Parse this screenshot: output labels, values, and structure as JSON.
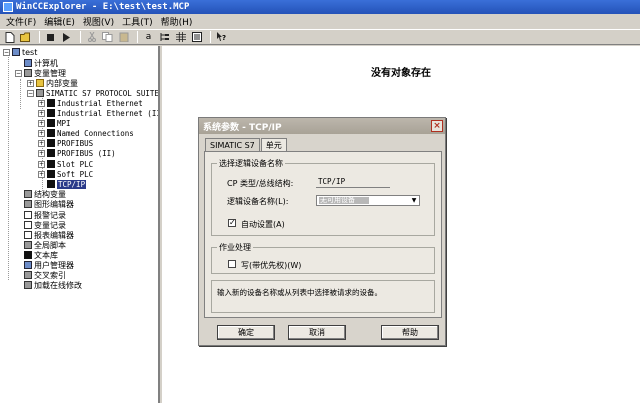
{
  "window": {
    "title": "WinCCExplorer - E:\\test\\test.MCP"
  },
  "menu": [
    "文件(F)",
    "编辑(E)",
    "视图(V)",
    "工具(T)",
    "帮助(H)"
  ],
  "toolbar": {
    "buttons": [
      "new-icon",
      "open-icon",
      "stop-icon",
      "run-icon",
      "cut-icon",
      "copy-icon",
      "paste-icon",
      "text-icon",
      "tree-icon",
      "grid-icon",
      "list-icon",
      "help-icon"
    ],
    "text_button_label": "a"
  },
  "tree": {
    "items": [
      {
        "label": "test",
        "expander": "−"
      },
      {
        "label": "计算机"
      },
      {
        "label": "变量管理",
        "expander": "−"
      },
      {
        "label": "内部变量",
        "expander": "+"
      },
      {
        "label": "SIMATIC S7 PROTOCOL SUITE",
        "expander": "−"
      },
      {
        "label": "Industrial Ethernet",
        "expander": "+"
      },
      {
        "label": "Industrial Ethernet (II)",
        "expander": "+"
      },
      {
        "label": "MPI",
        "expander": "+"
      },
      {
        "label": "Named Connections",
        "expander": "+"
      },
      {
        "label": "PROFIBUS",
        "expander": "+"
      },
      {
        "label": "PROFIBUS (II)",
        "expander": "+"
      },
      {
        "label": "Slot PLC",
        "expander": "+"
      },
      {
        "label": "Soft PLC",
        "expander": "+"
      },
      {
        "label": "TCP/IP",
        "selected": true
      },
      {
        "label": "结构变量"
      },
      {
        "label": "图形编辑器"
      },
      {
        "label": "报警记录"
      },
      {
        "label": "变量记录"
      },
      {
        "label": "报表编辑器"
      },
      {
        "label": "全局脚本"
      },
      {
        "label": "文本库"
      },
      {
        "label": "用户管理器"
      },
      {
        "label": "交叉索引"
      },
      {
        "label": "加载在线修改"
      }
    ]
  },
  "main": {
    "empty_message": "没有对象存在"
  },
  "dialog": {
    "title": "系统参数 - TCP/IP",
    "close_label": "×",
    "tabs": [
      "SIMATIC S7",
      "单元"
    ],
    "group1": {
      "title": "选择逻辑设备名称",
      "cp_type_label": "CP 类型/总线结构:",
      "cp_type_value": "TCP/IP",
      "logical_device_label": "逻辑设备名称(L):",
      "logical_device_value": "无可用设备",
      "auto_setting_label": "自动设置(A)",
      "auto_setting_checked": true,
      "check_mark": "✓"
    },
    "group2": {
      "title": "作业处理",
      "write_priority_label": "写(带优先权)(W)",
      "write_priority_checked": false
    },
    "hint": "输入新的设备名称或从列表中选择被请求的设备。",
    "buttons": {
      "ok": "确定",
      "cancel": "取消",
      "help": "帮助"
    }
  }
}
